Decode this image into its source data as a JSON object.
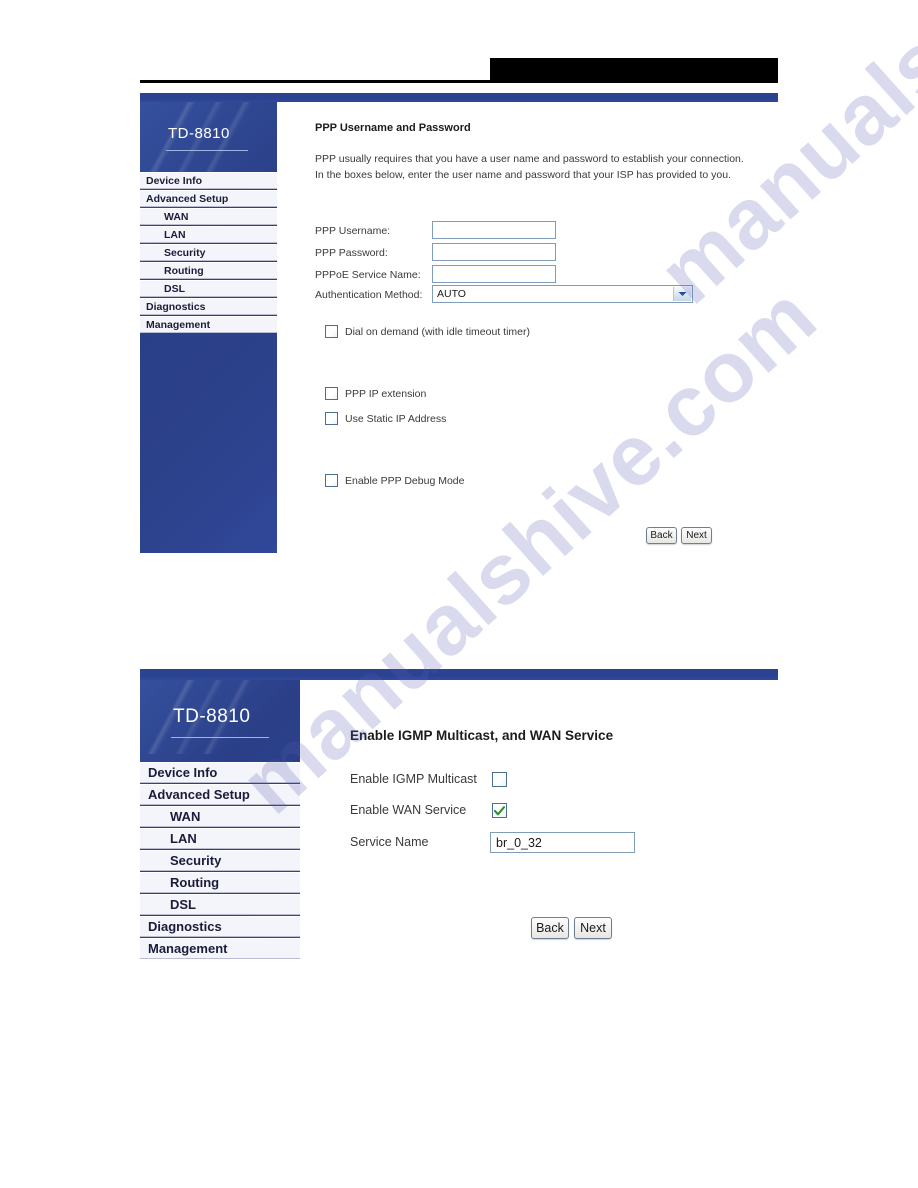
{
  "page": {
    "watermark_text": "manualshive.com"
  },
  "panel_one": {
    "brand": "TD-8810",
    "menu": [
      {
        "label": "Device Info",
        "indent": false
      },
      {
        "label": "Advanced Setup",
        "indent": false
      },
      {
        "label": "WAN",
        "indent": true
      },
      {
        "label": "LAN",
        "indent": true
      },
      {
        "label": "Security",
        "indent": true
      },
      {
        "label": "Routing",
        "indent": true
      },
      {
        "label": "DSL",
        "indent": true
      },
      {
        "label": "Diagnostics",
        "indent": false
      },
      {
        "label": "Management",
        "indent": false
      }
    ],
    "title": "PPP Username and Password",
    "paragraph_line_1": "PPP usually requires that you have a user name and password to establish your connection.",
    "paragraph_line_2": "In the boxes below, enter the user name and password that your ISP has provided to you.",
    "fields": {
      "ppp_username_label": "PPP Username:",
      "ppp_username_value": "",
      "ppp_password_label": "PPP Password:",
      "ppp_password_value": "",
      "pppoe_service_name_label": "PPPoE Service Name:",
      "pppoe_service_name_value": "",
      "auth_method_label": "Authentication Method:",
      "auth_method_value": "AUTO"
    },
    "checkboxes": [
      {
        "label": "Dial on demand (with idle timeout timer)",
        "checked": false
      },
      {
        "label": "PPP IP extension",
        "checked": false
      },
      {
        "label": "Use Static IP Address",
        "checked": false
      },
      {
        "label": "Enable PPP Debug Mode",
        "checked": false
      }
    ],
    "buttons": {
      "back": "Back",
      "next": "Next"
    }
  },
  "panel_two": {
    "brand": "TD-8810",
    "menu": [
      {
        "label": "Device Info",
        "indent": false
      },
      {
        "label": "Advanced Setup",
        "indent": false
      },
      {
        "label": "WAN",
        "indent": true
      },
      {
        "label": "LAN",
        "indent": true
      },
      {
        "label": "Security",
        "indent": true
      },
      {
        "label": "Routing",
        "indent": true
      },
      {
        "label": "DSL",
        "indent": true
      },
      {
        "label": "Diagnostics",
        "indent": false
      },
      {
        "label": "Management",
        "indent": false
      }
    ],
    "title": "Enable IGMP Multicast, and WAN Service",
    "rows": {
      "igmp_label": "Enable IGMP Multicast",
      "igmp_checked": false,
      "wan_label": "Enable WAN Service",
      "wan_checked": true,
      "service_name_label": "Service Name",
      "service_name_value": "br_0_32"
    },
    "buttons": {
      "back": "Back",
      "next": "Next"
    }
  },
  "colors": {
    "panel_blue": "#2b4189",
    "menu_bg": "#f4f5fa",
    "input_border": "#7f9db9",
    "check_green": "#2f8f2f",
    "watermark": "#5a5ab4"
  }
}
